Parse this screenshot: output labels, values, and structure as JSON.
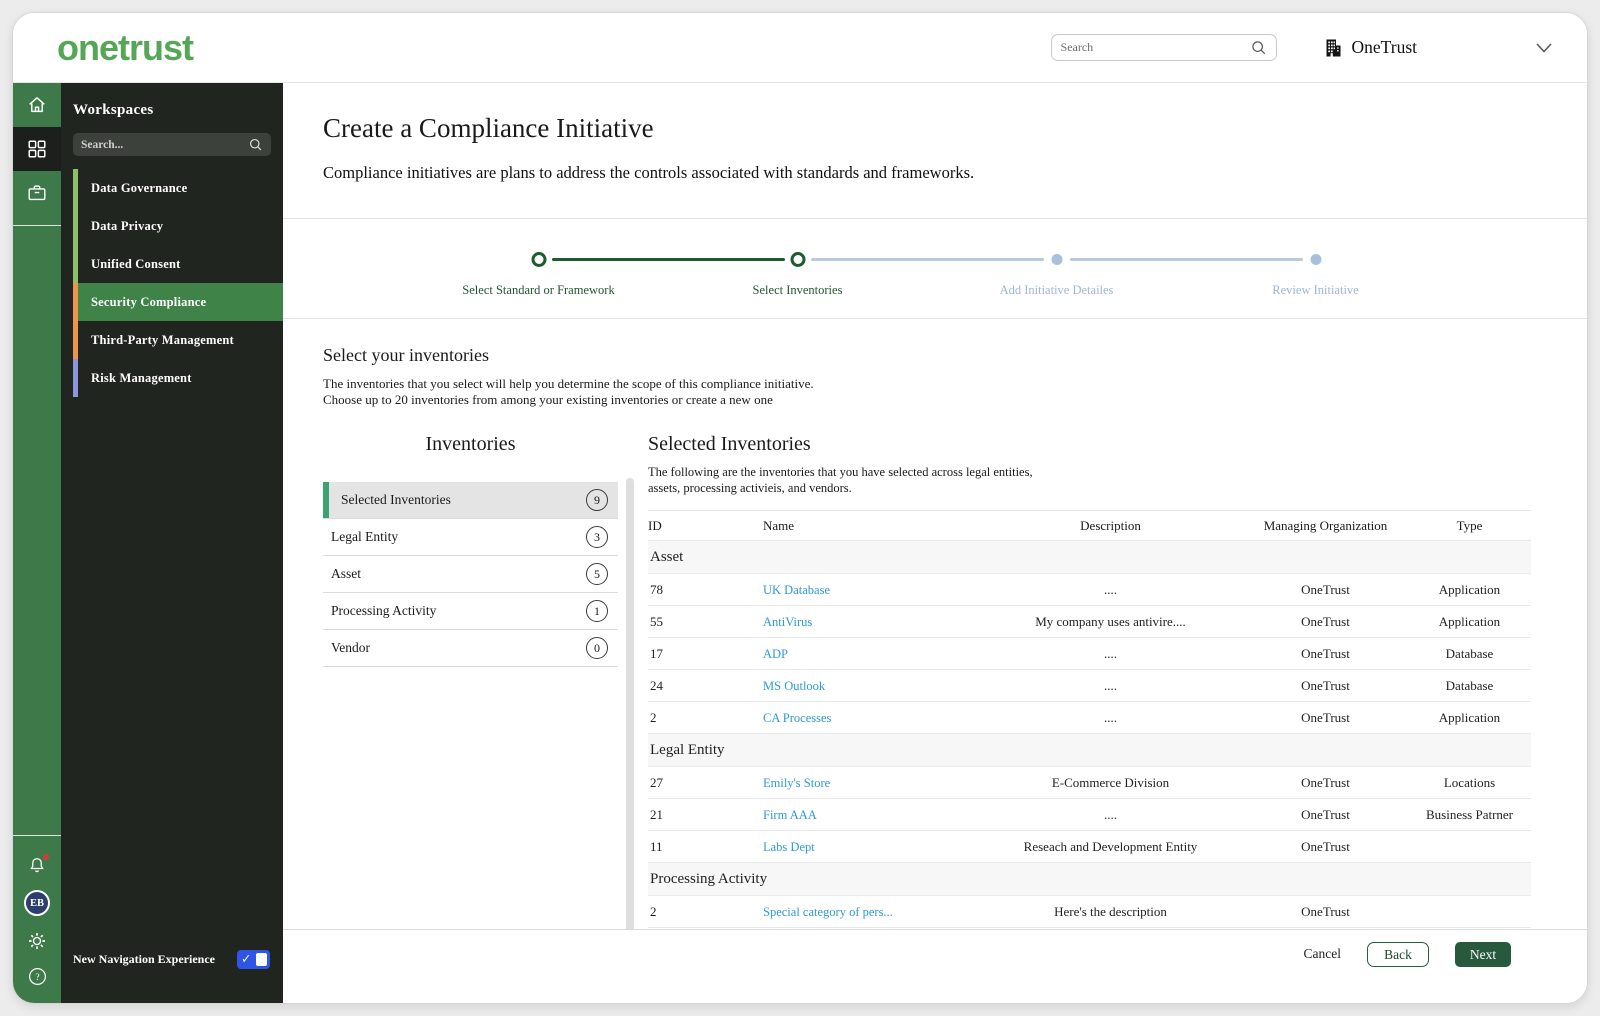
{
  "topbar": {
    "logo_text": "onetrust",
    "search_placeholder": "Search",
    "org_name": "OneTrust"
  },
  "workspaces": {
    "title": "Workspaces",
    "search_placeholder": "Search...",
    "items": [
      {
        "label": "Data Governance",
        "bar_color": "#8fc068",
        "active": false
      },
      {
        "label": "Data Privacy",
        "bar_color": "#8fc068",
        "active": false
      },
      {
        "label": "Unified Consent",
        "bar_color": "#8fc068",
        "active": false
      },
      {
        "label": "Security Compliance",
        "bar_color": "#ef944f",
        "active": true
      },
      {
        "label": "Third-Party Management",
        "bar_color": "#ef944f",
        "active": false
      },
      {
        "label": "Risk Management",
        "bar_color": "#8f94de",
        "active": false
      }
    ],
    "new_nav_label": "New Navigation Experience",
    "toggle_state": "on"
  },
  "avatar_initials": "EB",
  "page": {
    "title": "Create a Compliance Initiative",
    "subtitle": "Compliance initiatives are plans to address the controls associated with standards and frameworks."
  },
  "stepper": {
    "steps": [
      {
        "label": "Select Standard or Framework",
        "state": "done"
      },
      {
        "label": "Select Inventories",
        "state": "active"
      },
      {
        "label": "Add Initiative Detailes",
        "state": "upcoming"
      },
      {
        "label": "Review Initiative",
        "state": "upcoming"
      }
    ]
  },
  "section": {
    "title": "Select your inventories",
    "desc_line1": "The inventories that you select will help you determine the scope of this compliance initiative.",
    "desc_line2": "Choose up to 20 inventories from among your existing inventories or create a new one"
  },
  "inventories": {
    "title": "Inventories",
    "items": [
      {
        "label": "Selected Inventories",
        "count": "9",
        "selected": true
      },
      {
        "label": "Legal Entity",
        "count": "3",
        "selected": false
      },
      {
        "label": "Asset",
        "count": "5",
        "selected": false
      },
      {
        "label": "Processing Activity",
        "count": "1",
        "selected": false
      },
      {
        "label": "Vendor",
        "count": "0",
        "selected": false
      }
    ]
  },
  "selected_panel": {
    "title": "Selected Inventories",
    "desc_line1": "The following are the inventories that you have selected across legal entities,",
    "desc_line2": "assets, processing activieis, and vendors.",
    "columns": [
      "ID",
      "Name",
      "Description",
      "Managing Organization",
      "Type"
    ],
    "groups": [
      {
        "name": "Asset",
        "rows": [
          {
            "id": "78",
            "name": "UK Database",
            "description": "....",
            "org": "OneTrust",
            "type": "Application"
          },
          {
            "id": "55",
            "name": "AntiVirus",
            "description": "My company uses antivire....",
            "org": "OneTrust",
            "type": "Application"
          },
          {
            "id": "17",
            "name": "ADP",
            "description": "....",
            "org": "OneTrust",
            "type": "Database"
          },
          {
            "id": "24",
            "name": "MS Outlook",
            "description": "....",
            "org": "OneTrust",
            "type": "Database"
          },
          {
            "id": "2",
            "name": "CA Processes",
            "description": "....",
            "org": "OneTrust",
            "type": "Application"
          }
        ]
      },
      {
        "name": "Legal Entity",
        "rows": [
          {
            "id": "27",
            "name": "Emily's Store",
            "description": "E-Commerce Division",
            "org": "OneTrust",
            "type": "Locations"
          },
          {
            "id": "21",
            "name": "Firm AAA",
            "description": "....",
            "org": "OneTrust",
            "type": "Business Patrner"
          },
          {
            "id": "11",
            "name": "Labs Dept",
            "description": "Reseach and Development Entity",
            "org": "OneTrust",
            "type": ""
          }
        ]
      },
      {
        "name": "Processing Activity",
        "rows": [
          {
            "id": "2",
            "name": "Special category of pers...",
            "description": "Here's the description",
            "org": "OneTrust",
            "type": ""
          }
        ]
      }
    ]
  },
  "footer": {
    "cancel_label": "Cancel",
    "back_label": "Back",
    "next_label": "Next"
  },
  "icons": {
    "toggle_check": "✓",
    "help_glyph": "?"
  },
  "colors": {
    "brand_green": "#55a657",
    "rail_green": "#3e7949",
    "active_workspace_green": "#3f8349",
    "stepper_done_green": "#1d5c2f",
    "stepper_upcoming_blue": "#a9c0da",
    "link_blue": "#2e9ad6",
    "selected_item_bar": "#3aa273",
    "toggle_blue": "#2f55e8",
    "next_button_green": "#28593c"
  }
}
